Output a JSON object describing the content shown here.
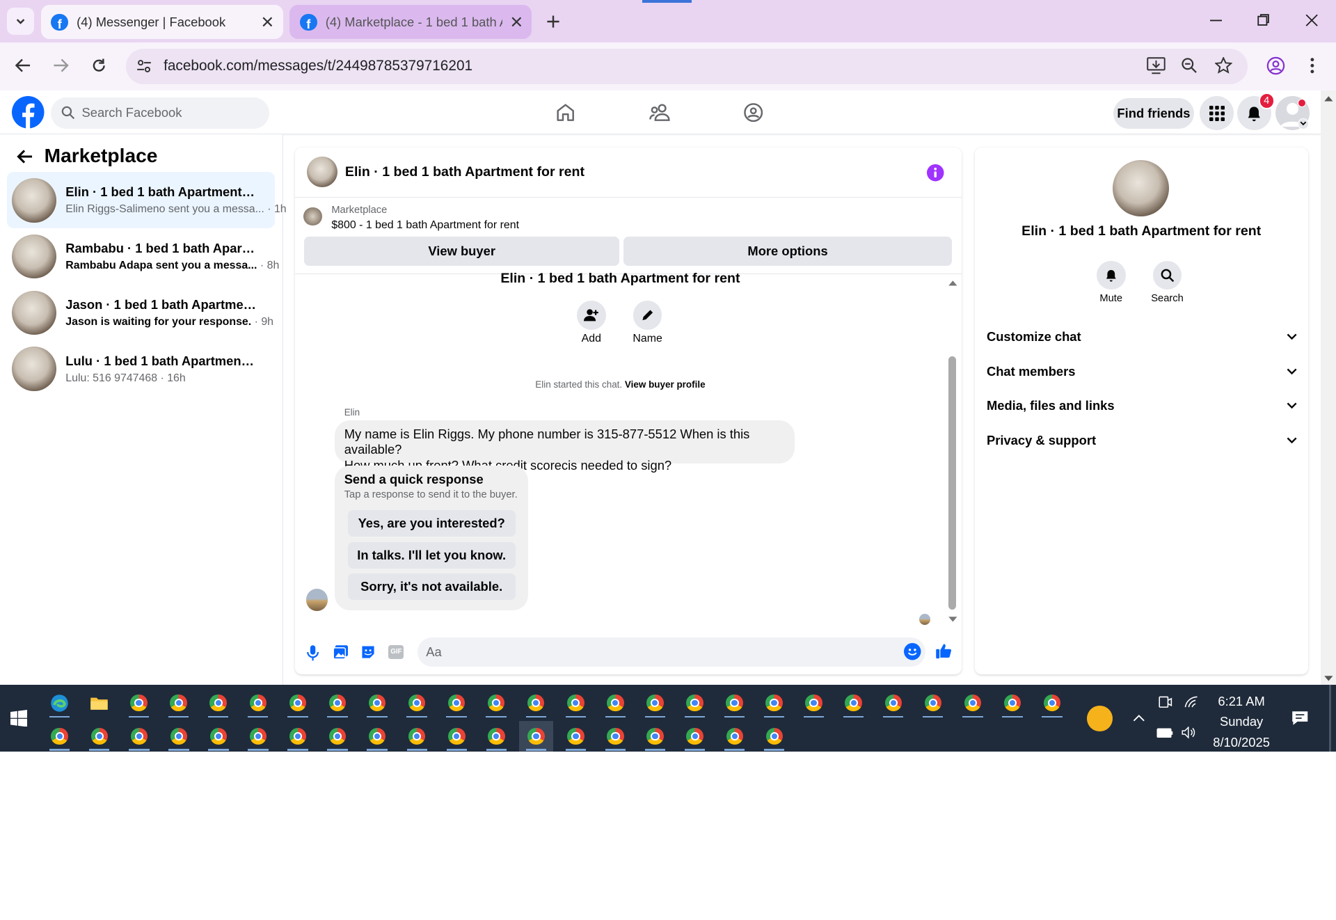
{
  "browser": {
    "tabs": [
      {
        "title": "(4) Messenger | Facebook",
        "active": true
      },
      {
        "title": "(4) Marketplace - 1 bed 1 bath A",
        "active": false
      }
    ],
    "url": "facebook.com/messages/t/24498785379716201"
  },
  "fb": {
    "search_placeholder": "Search Facebook",
    "find_friends": "Find friends",
    "notification_count": "4"
  },
  "left": {
    "title": "Marketplace",
    "conversations": [
      {
        "name": "Elin · 1 bed 1 bath Apartment for r...",
        "preview": "Elin Riggs-Salimeno sent you a messa...",
        "time": "· 1h",
        "unread": false
      },
      {
        "name": "Rambabu · 1 bed 1 bath Apartme...",
        "preview": "Rambabu Adapa sent you a messa...",
        "time": "· 8h",
        "unread": true
      },
      {
        "name": "Jason · 1 bed 1 bath Apartment f...",
        "preview": "Jason is waiting for your response.",
        "time": "· 9h",
        "unread": true
      },
      {
        "name": "Lulu · 1 bed 1 bath Apartment for r...",
        "preview": "Lulu: 516 9747468",
        "time": "· 16h",
        "unread": false
      }
    ]
  },
  "chat": {
    "header_title": "Elin · 1 bed 1 bath Apartment for rent",
    "listing_label": "Marketplace",
    "listing_title": "$800 - 1 bed 1 bath Apartment for rent",
    "view_buyer": "View buyer",
    "more_options": "More options",
    "intro_title": "Elin · 1 bed 1 bath Apartment for rent",
    "add_label": "Add",
    "name_label": "Name",
    "started_text": "Elin started this chat.",
    "view_buyer_profile": "View buyer profile",
    "sender": "Elin",
    "message_line1": "My name is Elin Riggs. My phone number is 315-877-5512 When is this available?",
    "message_line2": "How much up front? What credit scorecis needed to sign?",
    "quick_title": "Send a quick response",
    "quick_sub": "Tap a response to send it to the buyer.",
    "quick_responses": [
      "Yes, are you interested?",
      "In talks. I'll let you know.",
      "Sorry, it's not available."
    ],
    "composer_placeholder": "Aa"
  },
  "right": {
    "title": "Elin · 1 bed 1 bath Apartment for rent",
    "mute": "Mute",
    "search": "Search",
    "sections": [
      "Customize chat",
      "Chat members",
      "Media, files and links",
      "Privacy & support"
    ]
  },
  "taskbar": {
    "time": "6:21 AM",
    "day": "Sunday",
    "date": "8/10/2025"
  },
  "colors": {
    "fb_blue": "#0866ff",
    "accent_purple": "#a033ff",
    "tab_strip": "#e9d5f2",
    "taskbar": "#1f2b3b"
  }
}
